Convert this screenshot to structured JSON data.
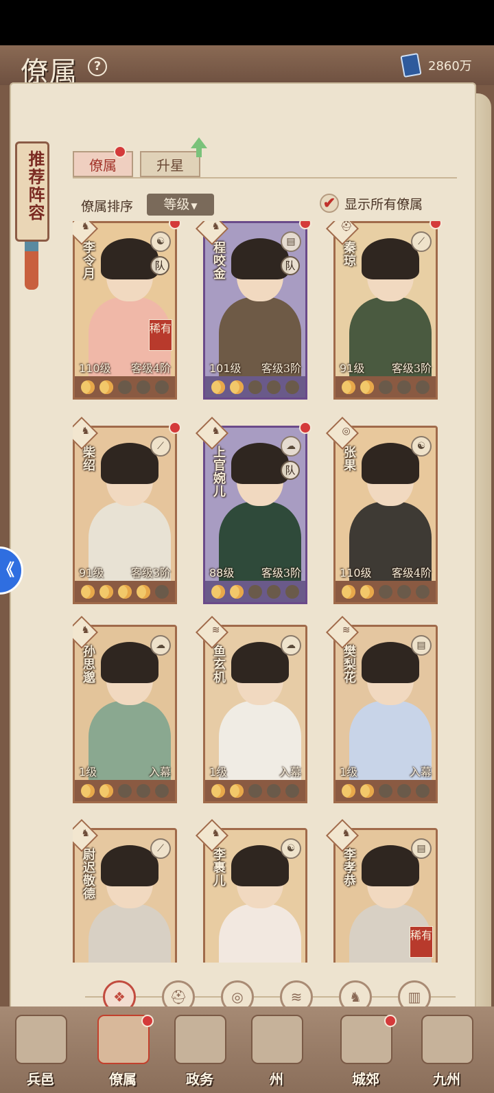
{
  "header": {
    "title": "僚属",
    "help": "?",
    "currency": "2860万"
  },
  "banner": "推荐阵容",
  "tabs": [
    {
      "label": "僚属"
    },
    {
      "label": "升星"
    }
  ],
  "sort": {
    "label": "僚属排序",
    "selected": "等级",
    "caret": "▼"
  },
  "show_all": {
    "label": "显示所有僚属",
    "check": "✔"
  },
  "cards": [
    {
      "name": "李令月",
      "level": "110级",
      "status": "客级4阶",
      "team": "队",
      "rare": "稀有",
      "stars": 2,
      "theme": "warm",
      "class_icon": "horse-icon",
      "attr_icon": "yinyang-icon"
    },
    {
      "name": "程咬金",
      "level": "101级",
      "status": "客级3阶",
      "team": "队",
      "rare": "",
      "stars": 2,
      "theme": "purple",
      "class_icon": "horse-icon",
      "attr_icon": "book-icon"
    },
    {
      "name": "秦琼",
      "level": "91级",
      "status": "客级3阶",
      "team": "",
      "rare": "",
      "stars": 2,
      "theme": "warm",
      "class_icon": "helmet-icon",
      "attr_icon": "sword-icon"
    },
    {
      "name": "柴绍",
      "level": "91级",
      "status": "客级3阶",
      "team": "",
      "rare": "",
      "stars": 4,
      "theme": "warm",
      "class_icon": "horse-icon",
      "attr_icon": "sword-icon"
    },
    {
      "name": "上官婉儿",
      "level": "88级",
      "status": "客级3阶",
      "team": "队",
      "rare": "",
      "stars": 2,
      "theme": "purple",
      "class_icon": "horse-icon",
      "attr_icon": "cloud-icon"
    },
    {
      "name": "张果",
      "level": "110级",
      "status": "客级4阶",
      "team": "",
      "rare": "",
      "stars": 2,
      "theme": "warm",
      "class_icon": "gourd-icon",
      "attr_icon": "yinyang-icon"
    },
    {
      "name": "孙思邈",
      "level": "1级",
      "status": "入幕",
      "team": "",
      "rare": "",
      "stars": 2,
      "theme": "warm",
      "class_icon": "horse-icon",
      "attr_icon": "cloud-icon"
    },
    {
      "name": "鱼玄机",
      "level": "1级",
      "status": "入幕",
      "team": "",
      "rare": "",
      "stars": 2,
      "theme": "warm",
      "class_icon": "fan-icon",
      "attr_icon": "cloud-icon"
    },
    {
      "name": "樊梨花",
      "level": "1级",
      "status": "入幕",
      "team": "",
      "rare": "",
      "stars": 2,
      "theme": "warm",
      "class_icon": "fan-icon",
      "attr_icon": "book-icon"
    },
    {
      "name": "尉迟敬德",
      "level": "",
      "status": "",
      "team": "",
      "rare": "",
      "stars": 0,
      "theme": "warm",
      "class_icon": "horse-icon",
      "attr_icon": "sword-icon"
    },
    {
      "name": "李裹儿",
      "level": "",
      "status": "",
      "team": "",
      "rare": "",
      "stars": 0,
      "theme": "warm",
      "class_icon": "horse-icon",
      "attr_icon": "yinyang-icon"
    },
    {
      "name": "李孝恭",
      "level": "",
      "status": "",
      "team": "",
      "rare": "稀有",
      "stars": 0,
      "theme": "warm",
      "class_icon": "horse-icon",
      "attr_icon": "book-icon"
    }
  ],
  "filters": [
    "all-icon",
    "helmet-icon",
    "gourd-icon",
    "fan-icon",
    "horse-icon",
    "scroll-icon"
  ],
  "nav": [
    {
      "label": "兵邑"
    },
    {
      "label": "僚属"
    },
    {
      "label": "政务"
    },
    {
      "label": "州"
    },
    {
      "label": "城郊"
    },
    {
      "label": "九州"
    }
  ],
  "side_button": "《"
}
